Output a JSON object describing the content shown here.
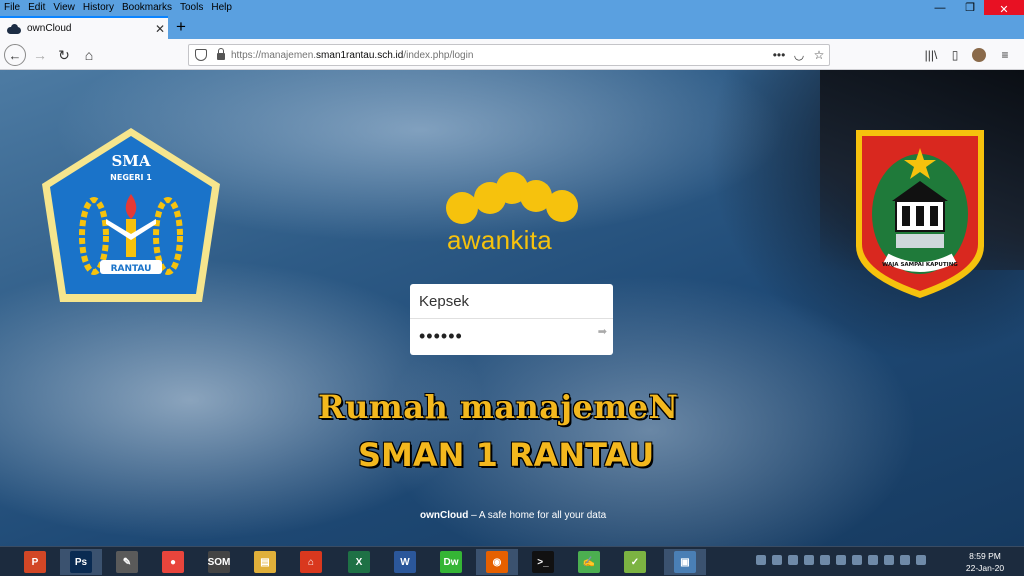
{
  "menu": [
    "File",
    "Edit",
    "View",
    "History",
    "Bookmarks",
    "Tools",
    "Help"
  ],
  "window_controls": {
    "minimize": "—",
    "maximize": "❐",
    "close": "✕"
  },
  "tab": {
    "title": "ownCloud",
    "close": "✕"
  },
  "newtab": "+",
  "nav": {
    "back": "←",
    "forward": "→",
    "reload": "↻",
    "home": "⌂"
  },
  "url": {
    "prefix": "https://manajemen.",
    "domain": "sman1rantau.sch.id",
    "path": "/index.php/login"
  },
  "url_icons": {
    "more": "•••",
    "pocket": "◡",
    "bookmark": "☆"
  },
  "toolbar_icons": {
    "library": "|||\\",
    "sidebar": "▯"
  },
  "sma_emblem": {
    "top_text": "SMA",
    "sub_text": "NEGERI 1",
    "ribbon_text": "RANTAU"
  },
  "regency_emblem": {
    "motto": "WAJA SAMPAI KAPUTING"
  },
  "logo": {
    "word": "awankita"
  },
  "login": {
    "username_value": "Kepsek",
    "password_value": "••••••",
    "submit": "➡"
  },
  "title_line1": "Rumah manajemeN",
  "title_line2": "SMAN 1 RANTAU",
  "footer": {
    "brand": "ownCloud",
    "tagline": " – A safe home for all your data"
  },
  "taskbar": {
    "apps": [
      {
        "name": "powerpoint",
        "label": "P",
        "color": "#d24726"
      },
      {
        "name": "photoshop",
        "label": "Ps",
        "color": "#0a2b52"
      },
      {
        "name": "pen-tool",
        "label": "✎",
        "color": "#5a5a5a"
      },
      {
        "name": "chrome",
        "label": "●",
        "color": "#e8453c"
      },
      {
        "name": "som",
        "label": "SOM",
        "color": "#444"
      },
      {
        "name": "file-explorer",
        "label": "▤",
        "color": "#e0b03a"
      },
      {
        "name": "pdf-reader",
        "label": "⌂",
        "color": "#d9381e"
      },
      {
        "name": "excel",
        "label": "X",
        "color": "#1e7145"
      },
      {
        "name": "word",
        "label": "W",
        "color": "#2b579a"
      },
      {
        "name": "dreamweaver",
        "label": "Dw",
        "color": "#35b535"
      },
      {
        "name": "firefox",
        "label": "◉",
        "color": "#e66000"
      },
      {
        "name": "terminal",
        "label": ">_",
        "color": "#111"
      },
      {
        "name": "notepad",
        "label": "✍",
        "color": "#4caf50"
      },
      {
        "name": "green-app",
        "label": "✓",
        "color": "#7cb342"
      },
      {
        "name": "window-app",
        "label": "▣",
        "color": "#4a7fb5"
      }
    ],
    "clock_time": "8:59 PM",
    "clock_date": "22-Jan-20"
  }
}
